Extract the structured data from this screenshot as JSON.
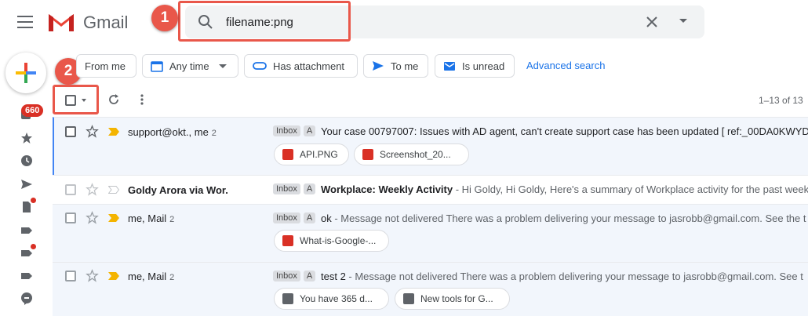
{
  "app": {
    "brand": "Gmail"
  },
  "search": {
    "query": "filename:png"
  },
  "steps": {
    "one": "1",
    "two": "2"
  },
  "left_rail": {
    "badge": "660"
  },
  "filters": {
    "from_me": "From me",
    "any_time": "Any time",
    "has_attachment": "Has attachment",
    "to_me": "To me",
    "is_unread": "Is unread",
    "advanced": "Advanced search"
  },
  "toolbar": {
    "count": "1–13 of 13"
  },
  "colors": {
    "accent": "#e9574a",
    "important": "#f4b400",
    "link": "#1a73e8"
  },
  "emails": [
    {
      "sender": "support@okt., me",
      "count": "2",
      "label": "Inbox",
      "a": "A",
      "subject": "Your case 00797007: Issues with AD agent, can't create support case has been updated [ ref:_00DA0KWYD",
      "snippet": "",
      "attachments": [
        "API.PNG",
        "Screenshot_20..."
      ]
    },
    {
      "sender": "Goldy Arora via Wor.",
      "count": "",
      "label": "Inbox",
      "a": "A",
      "subject": "Workplace: Weekly Activity",
      "snippet": " - Hi Goldy, Hi Goldy, Here's a summary of Workplace activity for the past week.",
      "attachments": []
    },
    {
      "sender": "me, Mail",
      "count": "2",
      "label": "Inbox",
      "a": "A",
      "subject": "ok",
      "snippet": " - Message not delivered There was a problem delivering your message to jasrobb@gmail.com. See the t",
      "attachments": [
        "What-is-Google-..."
      ]
    },
    {
      "sender": "me, Mail",
      "count": "2",
      "label": "Inbox",
      "a": "A",
      "subject": "test 2",
      "snippet": " - Message not delivered There was a problem delivering your message to jasrobb@gmail.com. See t",
      "attachments": [
        "You have 365 d...",
        "New tools for G..."
      ]
    }
  ]
}
